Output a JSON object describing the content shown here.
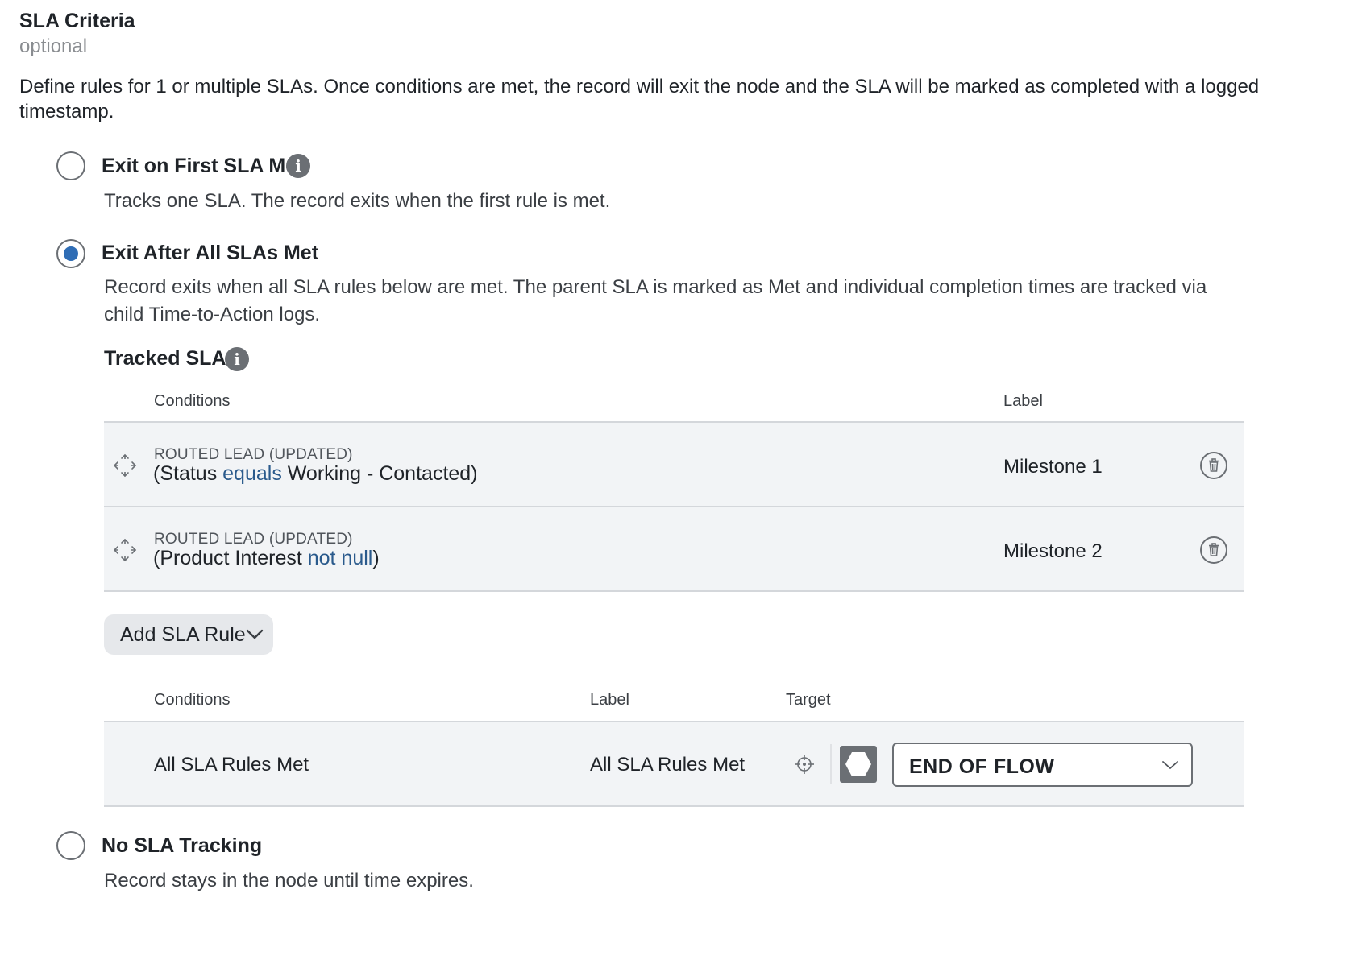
{
  "header": {
    "title": "SLA Criteria",
    "optional": "optional",
    "description": "Define rules for 1 or multiple SLAs. Once conditions are met, the record will exit the node and the SLA will be marked as completed with a logged timestamp."
  },
  "options": [
    {
      "label": "Exit on First SLA Met",
      "description": "Tracks one SLA. The record exits when the first rule is met.",
      "selected": false
    },
    {
      "label": "Exit After All SLAs Met",
      "description": "Record exits when all SLA rules below are met. The parent SLA is marked as Met and individual completion times are tracked via child Time-to-Action logs.",
      "selected": true
    },
    {
      "label": "No SLA Tracking",
      "description": "Record stays in the node until time expires.",
      "selected": false
    }
  ],
  "tracked": {
    "title": "Tracked SLAs",
    "col_conditions": "Conditions",
    "col_label": "Label",
    "rows": [
      {
        "caption": "ROUTED LEAD (UPDATED)",
        "expr_open": "(Status ",
        "expr_keyword": "equals",
        "expr_rest": " Working - Contacted)",
        "label": "Milestone 1"
      },
      {
        "caption": "ROUTED LEAD (UPDATED)",
        "expr_open": "(Product Interest ",
        "expr_keyword": "not null",
        "expr_rest": ")",
        "label": "Milestone 2"
      }
    ]
  },
  "add_rule": {
    "label": "Add SLA Rule"
  },
  "completion": {
    "col_conditions": "Conditions",
    "col_label": "Label",
    "col_target": "Target",
    "condition": "All SLA Rules Met",
    "label": "All SLA Rules Met",
    "target_value": "END OF FLOW"
  },
  "colors": {
    "accent": "#2f6db5",
    "keyword": "#2a5a8c",
    "row_bg": "#f2f4f6",
    "icon_gray": "#6b6f74"
  },
  "icons": [
    "info-icon",
    "move-icon",
    "trash-icon",
    "chevron-down-icon",
    "crosshair-icon",
    "hexagon-icon"
  ]
}
